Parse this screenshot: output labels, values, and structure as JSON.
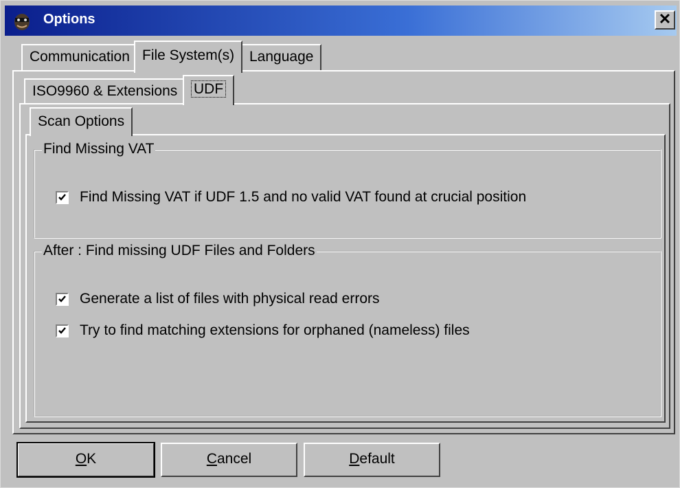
{
  "window": {
    "title": "Options",
    "close_label": "✕"
  },
  "tabs_top": [
    {
      "label": "Communication"
    },
    {
      "label": "File System(s)"
    },
    {
      "label": "Language"
    }
  ],
  "tabs_fs": [
    {
      "label": "ISO9960 & Extensions"
    },
    {
      "label": "UDF"
    }
  ],
  "tabs_udf": [
    {
      "label": "Scan Options"
    }
  ],
  "group1": {
    "title": "Find Missing VAT",
    "items": [
      {
        "label": "Find Missing VAT if UDF 1.5 and no valid VAT found at crucial position",
        "checked": true
      }
    ]
  },
  "group2": {
    "title": "After : Find missing UDF Files and Folders",
    "items": [
      {
        "label": "Generate a list of files with physical read errors",
        "checked": true
      },
      {
        "label": "Try to find matching extensions for orphaned (nameless) files",
        "checked": true
      }
    ]
  },
  "buttons": {
    "ok_mn": "O",
    "ok_rest": "K",
    "cancel_mn": "C",
    "cancel_rest": "ancel",
    "default_mn": "D",
    "default_rest": "efault"
  }
}
